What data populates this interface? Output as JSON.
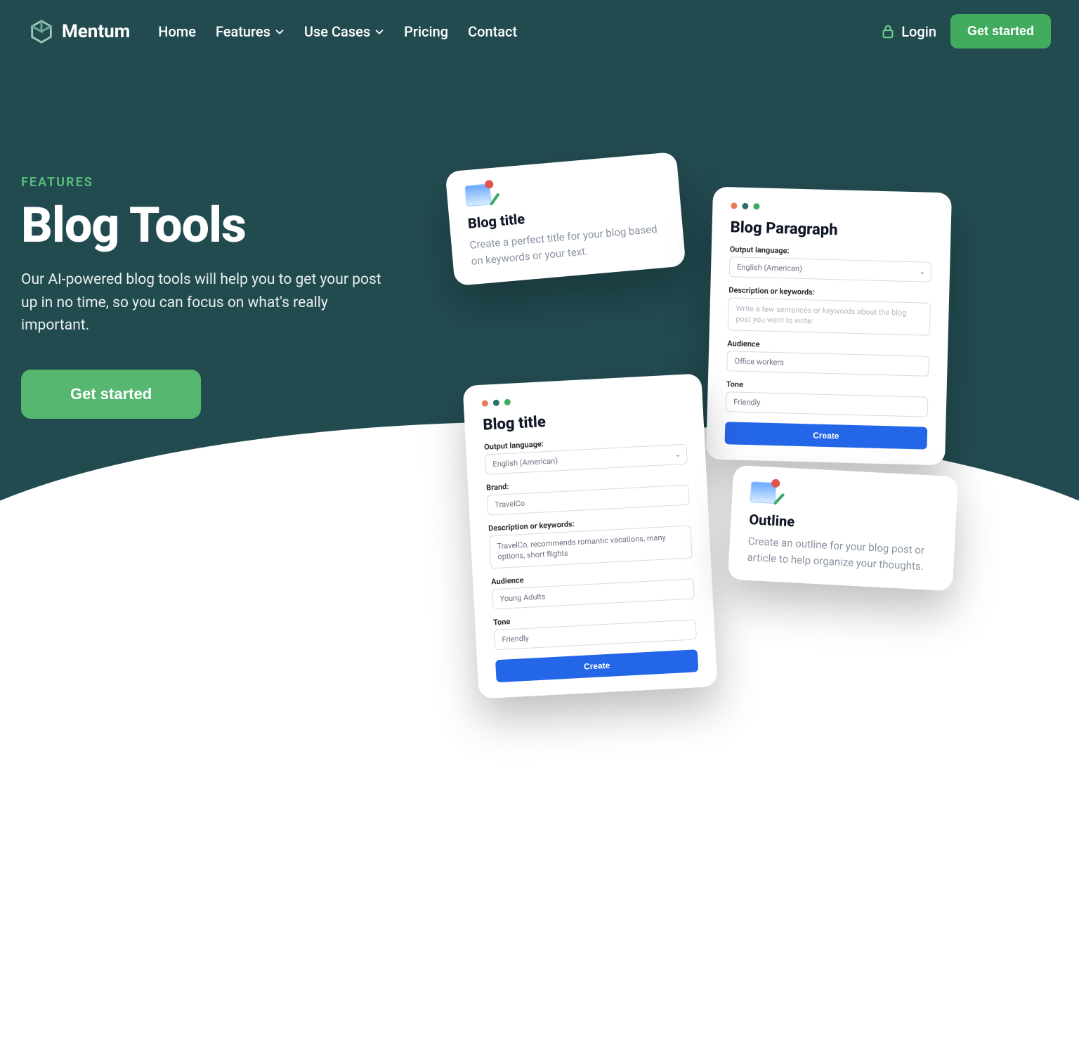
{
  "brand": "Mentum",
  "nav": {
    "items": [
      "Home",
      "Features",
      "Use Cases",
      "Pricing",
      "Contact"
    ],
    "login": "Login",
    "cta": "Get started"
  },
  "hero": {
    "eyebrow": "FEATURES",
    "title": "Blog Tools",
    "subtitle": "Our AI-powered blog tools will help you to get your post up in no time, so you can focus on what's really important.",
    "cta": "Get started"
  },
  "cards": {
    "blog_title_desc": {
      "title": "Blog title",
      "text": "Create a perfect title for your blog based on keywords or your text."
    },
    "outline_desc": {
      "title": "Outline",
      "text": "Create an outline for your blog post or article to help organize your thoughts."
    },
    "blog_paragraph": {
      "title": "Blog Paragraph",
      "labels": {
        "lang": "Output language:",
        "desc": "Description or keywords:",
        "aud": "Audience",
        "tone": "Tone"
      },
      "values": {
        "lang": "English (American)",
        "desc_placeholder": "Write a few sentences or keywords about the blog post you want to write:",
        "aud": "Office workers",
        "tone": "Friendly"
      },
      "button": "Create"
    },
    "blog_title_form": {
      "title": "Blog title",
      "labels": {
        "lang": "Output language:",
        "brand": "Brand:",
        "desc": "Description or keywords:",
        "aud": "Audience",
        "tone": "Tone"
      },
      "values": {
        "lang": "English (American)",
        "brand": "TravelCo",
        "desc": "TravelCo, recommends romantic vacations, many options, short flights",
        "aud": "Young Adults",
        "tone": "Friendly"
      },
      "button": "Create"
    }
  }
}
